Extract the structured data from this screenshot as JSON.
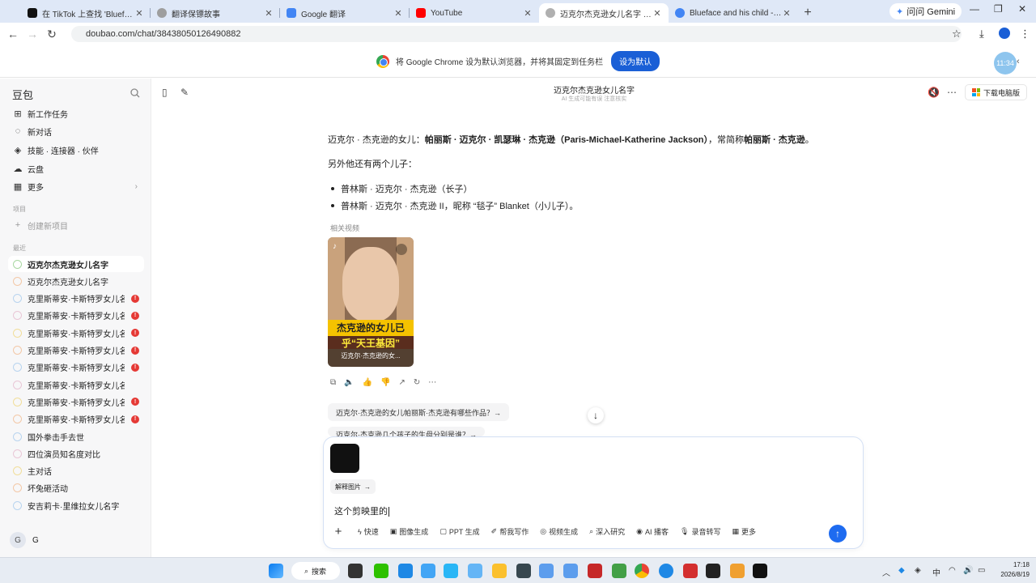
{
  "browser": {
    "tabs": [
      {
        "title": "在 TikTok 上查找 'Blueface and his child'",
        "color": "#111111"
      },
      {
        "title": "翻译保镖故事",
        "color": "#9e9e9e"
      },
      {
        "title": "Google 翻译",
        "color": "#4285f4"
      },
      {
        "title": "YouTube",
        "color": "#ff0000"
      },
      {
        "title": "迈克尔杰克逊女儿名字 - 豆包",
        "color": "#b0b0b0",
        "active": true
      },
      {
        "title": "Blueface and his child - Google",
        "color": "#4285f4"
      }
    ],
    "gemini_label": "问问 Gemini",
    "url": "doubao.com/chat/38438050126490882",
    "infobar_text": "将 Google Chrome 设为默认浏览器，并将其固定到任务栏",
    "infobar_button": "设为默认",
    "clock_bubble": "11:34"
  },
  "sidebar": {
    "logo": "豆包",
    "nav": [
      {
        "label": "新工作任务",
        "icon": "plus-square-icon"
      },
      {
        "label": "新对话",
        "icon": "chat-bubble-icon"
      },
      {
        "label": "技能 · 连接器 · 伙伴",
        "icon": "layers-icon"
      },
      {
        "label": "云盘",
        "icon": "cloud-icon"
      },
      {
        "label": "更多",
        "icon": "grid-icon"
      }
    ],
    "projects_header": "项目",
    "new_project": "创建新项目",
    "recent_header": "最近",
    "recent": [
      {
        "label": "迈克尔杰克逊女儿名字",
        "active": true,
        "badge": false
      },
      {
        "label": "迈克尔杰克逊女儿名字",
        "badge": false
      },
      {
        "label": "克里斯蒂安·卡斯特罗女儿名字",
        "badge": true
      },
      {
        "label": "克里斯蒂安·卡斯特罗女儿名字",
        "badge": true
      },
      {
        "label": "克里斯蒂安·卡斯特罗女儿名字",
        "badge": true
      },
      {
        "label": "克里斯蒂安·卡斯特罗女儿名字",
        "badge": true
      },
      {
        "label": "克里斯蒂安·卡斯特罗女儿名字",
        "badge": true
      },
      {
        "label": "克里斯蒂安·卡斯特罗女儿名字",
        "badge": false
      },
      {
        "label": "克里斯蒂安·卡斯特罗女儿名字",
        "badge": true
      },
      {
        "label": "克里斯蒂安·卡斯特罗女儿名字",
        "badge": true
      },
      {
        "label": "国外拳击手去世",
        "badge": false
      },
      {
        "label": "四位演员知名度对比",
        "badge": false
      },
      {
        "label": "主对话",
        "badge": false
      },
      {
        "label": "坏兔砸活动",
        "badge": false
      },
      {
        "label": "安吉莉卡·里维拉女儿名字",
        "badge": false
      }
    ],
    "badge_text": "!",
    "user_initial": "G",
    "user_name": "G"
  },
  "chat": {
    "title": "迈克尔杰克逊女儿名字",
    "subtitle": "AI 生成可能有误 注意核实",
    "download_label": "下载电脑版",
    "para1_prefix": "迈克尔 · 杰克逊的女儿：",
    "para1_bold": "帕丽斯 · 迈克尔 · 凯瑟琳 · 杰克逊（Paris-Michael-Katherine Jackson）",
    "para1_mid": "，常简称",
    "para1_bold2": "帕丽斯 · 杰克逊",
    "para1_end": "。",
    "para2": "另外他还有两个儿子：",
    "list": [
      "普林斯 · 迈克尔 · 杰克逊（长子）",
      "普林斯 · 迈克尔 · 杰克逊 II，昵称 “毯子” Blanket（小儿子）。"
    ],
    "related_videos": "相关视频",
    "video": {
      "banner1": "杰克逊的女儿已",
      "banner2": "乎“天王基因”",
      "caption": "迈克尔·杰克逊的女..."
    },
    "suggestions": [
      "迈克尔·杰克逊的女儿帕丽斯·杰克逊有哪些作品？→",
      "迈克尔·杰克逊几个孩子的生母分别是谁？→"
    ]
  },
  "composer": {
    "explain_label": "解释图片",
    "input_value": "这个剪映里的",
    "tools": [
      {
        "label": "快速",
        "icon": "lightning-icon"
      },
      {
        "label": "图像生成",
        "icon": "image-icon"
      },
      {
        "label": "PPT 生成",
        "icon": "ppt-icon"
      },
      {
        "label": "帮我写作",
        "icon": "pen-icon"
      },
      {
        "label": "视频生成",
        "icon": "video-icon"
      },
      {
        "label": "深入研究",
        "icon": "telescope-icon"
      },
      {
        "label": "AI 播客",
        "icon": "podcast-icon"
      },
      {
        "label": "录音转写",
        "icon": "mic-icon"
      },
      {
        "label": "更多",
        "icon": "grid-icon"
      }
    ]
  },
  "taskbar": {
    "search_label": "搜索",
    "ime": "中",
    "time": "17:18",
    "date": "2026/8/19"
  }
}
